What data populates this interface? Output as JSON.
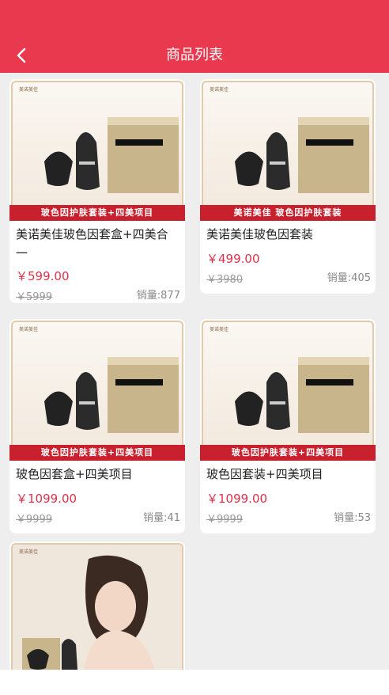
{
  "header": {
    "title": "商品列表",
    "back_icon": "chevron-left-icon"
  },
  "colors": {
    "header": "#e8394e",
    "price": "#e1304a",
    "banner": "#c8202d"
  },
  "products": [
    {
      "banner": "玻色因护肤套装+四美项目",
      "name": "美诺美佳玻色因套盒+四美合一",
      "price": "￥599.00",
      "original_price": "￥5999",
      "sales": "销量:877"
    },
    {
      "banner": "美诺美佳  玻色因护肤套装",
      "name": "美诺美佳玻色因套装",
      "price": "￥499.00",
      "original_price": "￥3980",
      "sales": "销量:405"
    },
    {
      "banner": "玻色因护肤套装+四美项目",
      "name": "玻色因套盒+四美项目",
      "price": "￥1099.00",
      "original_price": "￥9999",
      "sales": "销量:41"
    },
    {
      "banner": "玻色因护肤套装+四美项目",
      "name": "玻色因套装+四美项目",
      "price": "￥1099.00",
      "original_price": "￥9999",
      "sales": "销量:53"
    }
  ]
}
